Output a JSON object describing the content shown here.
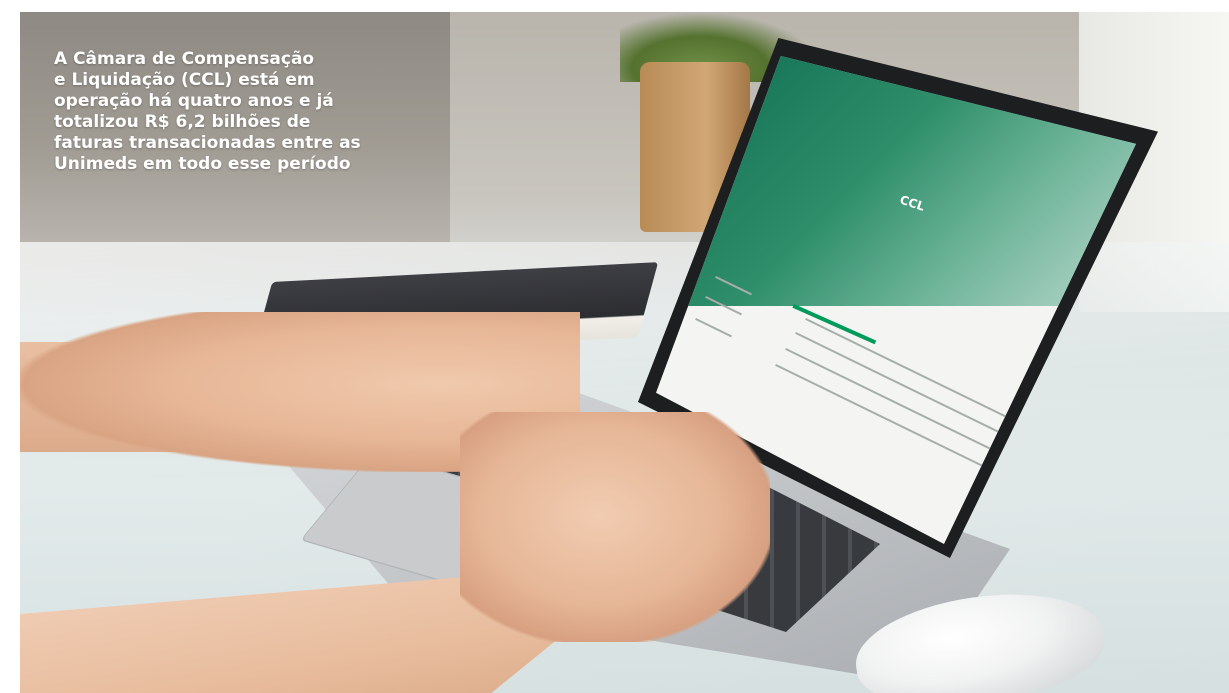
{
  "caption": {
    "lines": [
      "A Câmara de Compensação",
      "e Liquidação (CCL) está em",
      "operação há quatro anos e já",
      "totalizou R$ 6,2 bilhões de",
      "faturas transacionadas entre as",
      "Unimeds em todo esse período"
    ]
  },
  "screen": {
    "hero_badge": "CCL"
  },
  "colors": {
    "caption_text": "#ffffff",
    "brand_green": "#0a6a4e",
    "accent_green": "#009a5a"
  }
}
